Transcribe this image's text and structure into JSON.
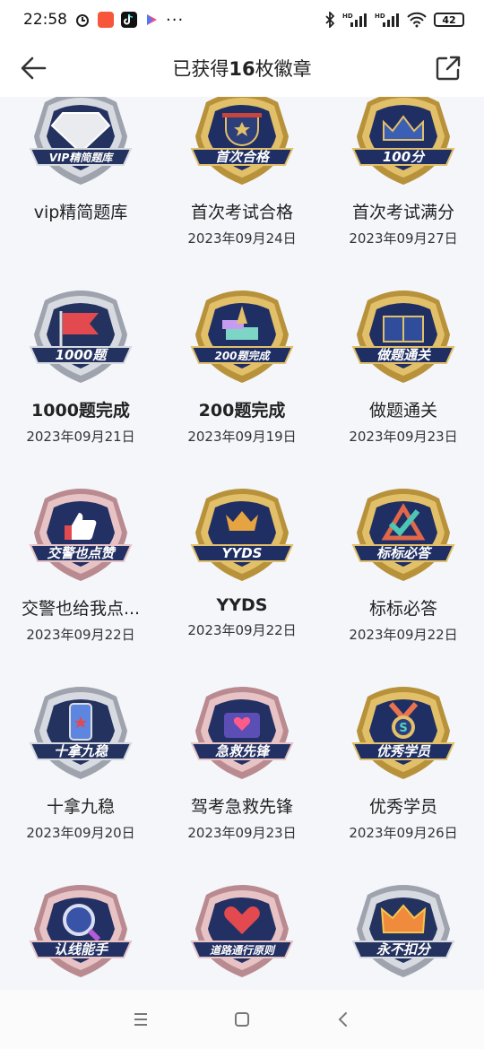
{
  "status_bar": {
    "time": "22:58",
    "battery": "42",
    "dots": "···",
    "hd1": "HD",
    "hd2": "HD"
  },
  "header": {
    "title_prefix": "已获得",
    "count": "16",
    "title_suffix": "枚徽章"
  },
  "badges": [
    {
      "name": "vip精简题库",
      "date": "",
      "art_text": "VIP精简题库",
      "style": "silver",
      "icon": "diamond-icon"
    },
    {
      "name": "首次考试合格",
      "date": "2023年09月24日",
      "art_text": "首次合格",
      "style": "gold",
      "icon": "trophy-icon"
    },
    {
      "name": "首次考试满分",
      "date": "2023年09月27日",
      "art_text": "100分",
      "style": "gold",
      "icon": "crown-chart-icon"
    },
    {
      "name": "1000题完成",
      "date": "2023年09月21日",
      "art_text": "1000题",
      "style": "silver",
      "icon": "flag-icon"
    },
    {
      "name": "200题完成",
      "date": "2023年09月19日",
      "art_text": "200题完成",
      "style": "gold",
      "icon": "pen-books-icon"
    },
    {
      "name": "做题通关",
      "date": "2023年09月23日",
      "art_text": "做题通关",
      "style": "gold",
      "icon": "book-icon"
    },
    {
      "name": "交警也给我点...",
      "date": "2023年09月22日",
      "art_text": "交警也点赞",
      "style": "rose",
      "icon": "thumbs-up-icon"
    },
    {
      "name": "YYDS",
      "date": "2023年09月22日",
      "art_text": "YYDS",
      "style": "gold",
      "icon": "crown-hand-icon"
    },
    {
      "name": "标标必答",
      "date": "2023年09月22日",
      "art_text": "标标必答",
      "style": "gold",
      "icon": "check-triangle-icon"
    },
    {
      "name": "十拿九稳",
      "date": "2023年09月20日",
      "art_text": "十拿九稳",
      "style": "silver",
      "icon": "phone-hand-icon"
    },
    {
      "name": "驾考急救先锋",
      "date": "2023年09月23日",
      "art_text": "急救先锋",
      "style": "rose",
      "icon": "first-aid-kit-icon"
    },
    {
      "name": "优秀学员",
      "date": "2023年09月26日",
      "art_text": "优秀学员",
      "style": "gold",
      "icon": "medal-icon"
    },
    {
      "name": "认线能手",
      "date": "",
      "art_text": "认线能手",
      "style": "rose",
      "icon": "magnifier-icon"
    },
    {
      "name": "道路通行原则",
      "date": "",
      "art_text": "道路通行原则",
      "style": "rose",
      "icon": "heart-hands-icon"
    },
    {
      "name": "永不扣分",
      "date": "",
      "art_text": "永不扣分",
      "style": "silver",
      "icon": "crown-icon"
    }
  ],
  "colors": {
    "gold": "#d9b45a",
    "silver": "#c9ccd3",
    "rose": "#e0b7b9",
    "navy": "#1f2f63"
  }
}
